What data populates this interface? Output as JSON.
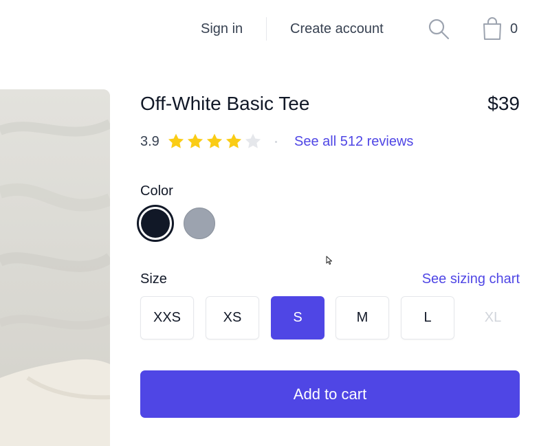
{
  "header": {
    "sign_in": "Sign in",
    "create_account": "Create account",
    "search_icon": "search-icon",
    "cart_icon": "shopping-bag-icon",
    "cart_count": "0"
  },
  "product": {
    "name": "Off-White Basic Tee",
    "price": "$39",
    "rating_value": "3.9",
    "rating_stars": 4,
    "rating_max": 5,
    "reviews_link": "See all 512 reviews",
    "image_icon": "product-photo"
  },
  "color": {
    "label": "Color",
    "options": [
      {
        "color": "#111827",
        "selected": true
      },
      {
        "color": "#9ca3af",
        "selected": false
      }
    ]
  },
  "size": {
    "label": "Size",
    "chart_link": "See sizing chart",
    "options": [
      {
        "label": "XXS",
        "state": "available"
      },
      {
        "label": "XS",
        "state": "available"
      },
      {
        "label": "S",
        "state": "selected"
      },
      {
        "label": "M",
        "state": "available"
      },
      {
        "label": "L",
        "state": "available"
      },
      {
        "label": "XL",
        "state": "disabled"
      }
    ]
  },
  "cta": {
    "add_to_cart": "Add to cart"
  },
  "colors": {
    "accent": "#4f46e5",
    "star_filled": "#facc15",
    "star_empty": "#e5e7eb",
    "text_primary": "#111827",
    "text_secondary": "#374151"
  }
}
